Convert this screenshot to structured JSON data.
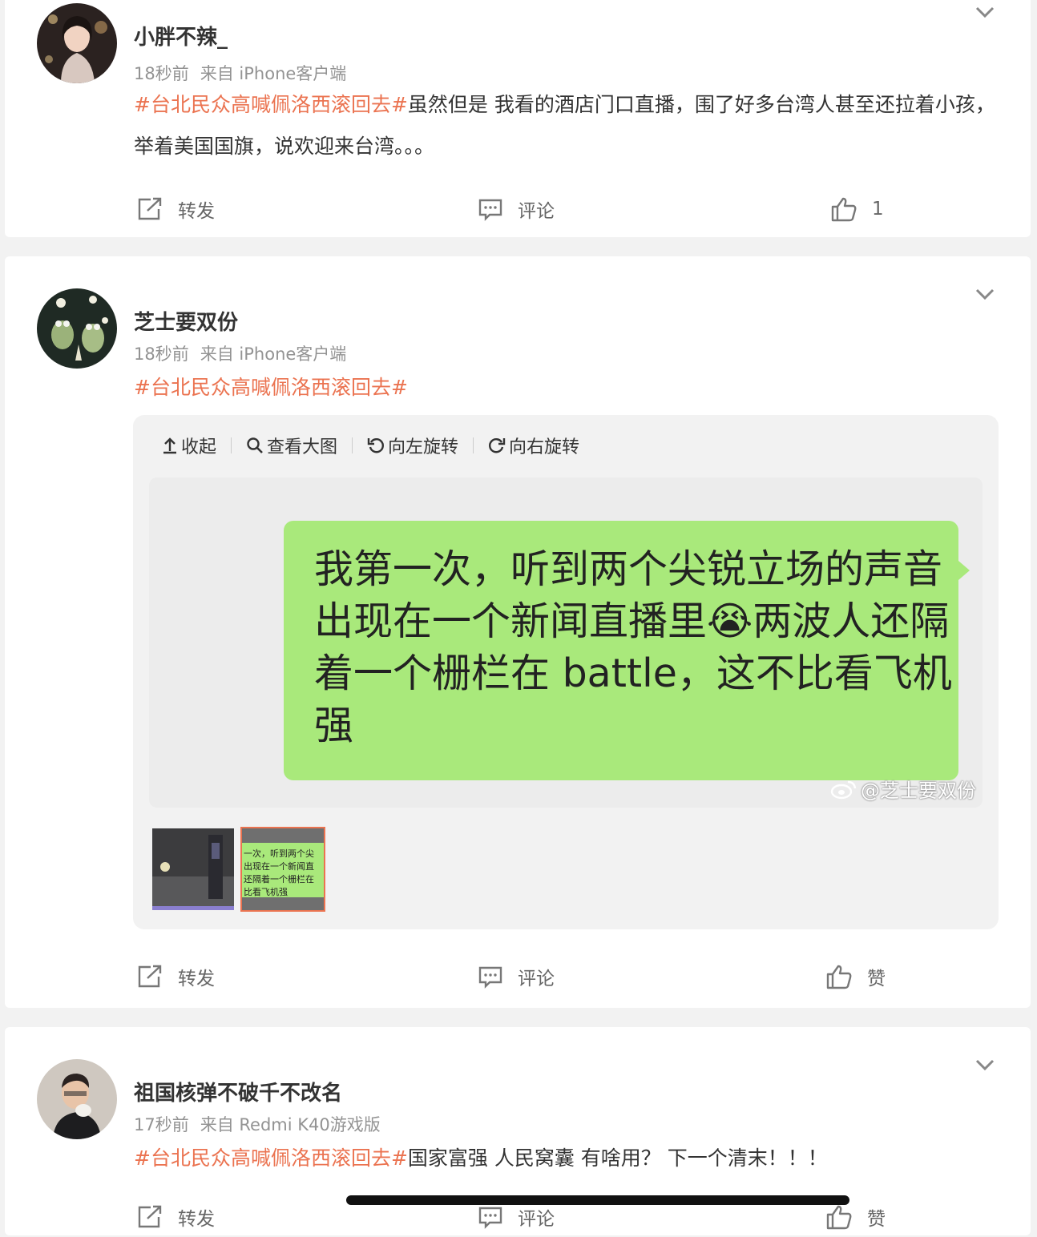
{
  "posts": [
    {
      "username": "小胖不辣_",
      "time": "18秒前",
      "source": "来自 iPhone客户端",
      "topic": "#台北民众高喊佩洛西滚回去#",
      "text": "虽然但是 我看的酒店门口直播，围了好多台湾人甚至还拉着小孩，举着美国国旗，说欢迎来台湾。。。",
      "actions": {
        "repost": "转发",
        "comment": "评论",
        "like": "1"
      }
    },
    {
      "username": "芝士要双份",
      "time": "18秒前",
      "source": "来自 iPhone客户端",
      "topic": "#台北民众高喊佩洛西滚回去#",
      "text": "",
      "media": {
        "toolbar": {
          "collapse": "收起",
          "view_large": "查看大图",
          "rotate_left": "向左旋转",
          "rotate_right": "向右旋转"
        },
        "image_text": "我第一次，听到两个尖锐立场的声音出现在一个新闻直播里😭两波人还隔着一个栅栏在 battle，这不比看飞机强",
        "watermark": "@芝士要双份",
        "thumb_text": "一次，听到两个尖\n出现在一个新闻直\n还隔着一个栅栏在\n比看飞机强"
      },
      "actions": {
        "repost": "转发",
        "comment": "评论",
        "like": "赞"
      }
    },
    {
      "username": "祖国核弹不破千不改名",
      "time": "17秒前",
      "source": "来自 Redmi K40游戏版",
      "topic": "#台北民众高喊佩洛西滚回去#",
      "text": "国家富强 人民窝囊 有啥用？ 下一个清末！！！",
      "actions": {
        "repost": "转发",
        "comment": "评论",
        "like": "赞"
      }
    }
  ],
  "colors": {
    "topic": "#eb7350",
    "bubble": "#a9e97b",
    "meta": "#939393"
  }
}
